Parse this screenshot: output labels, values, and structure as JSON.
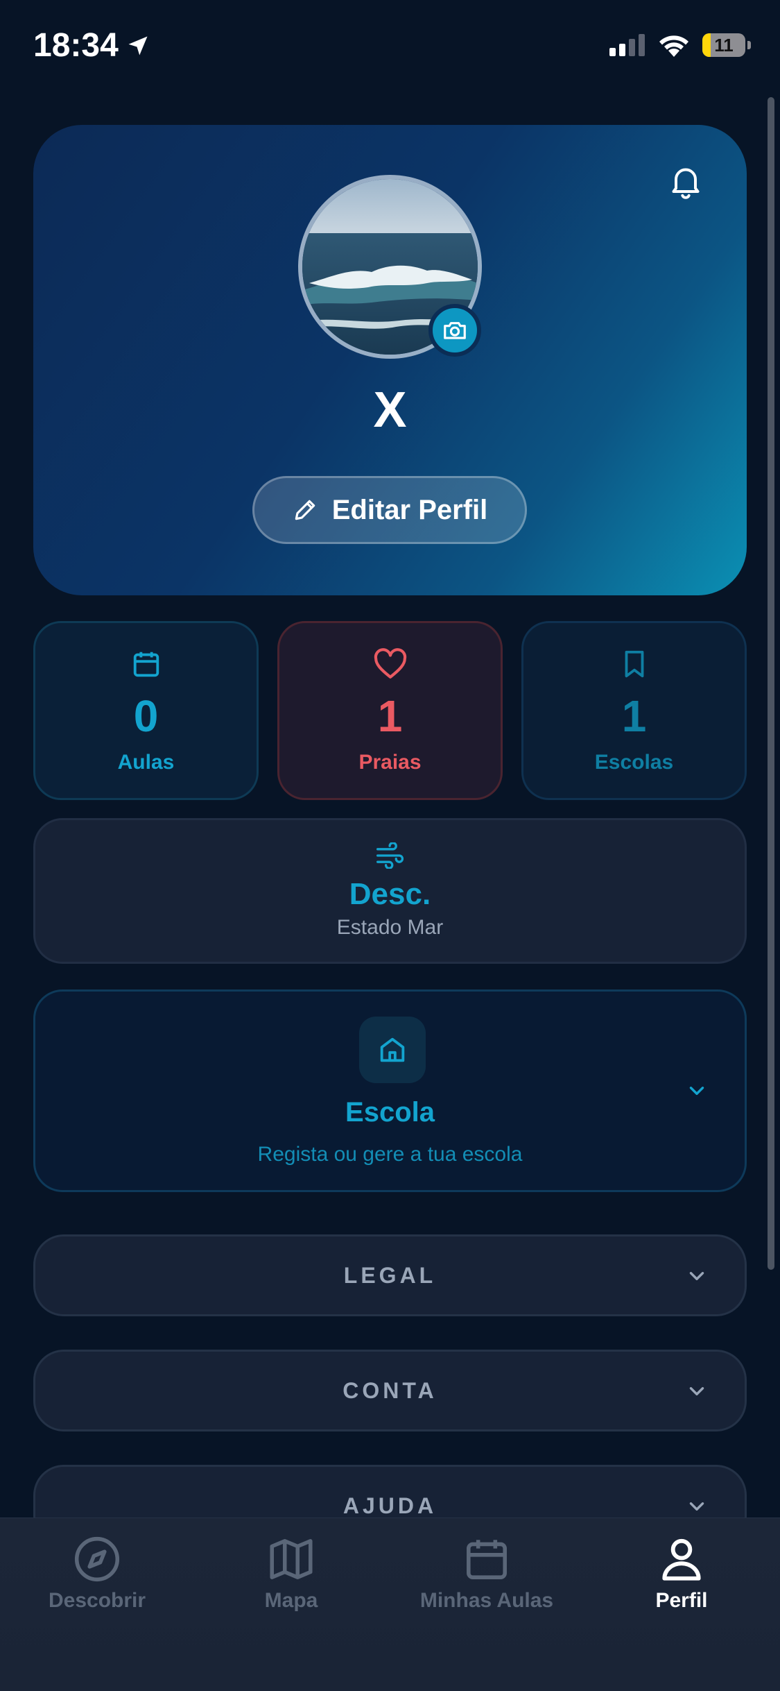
{
  "status_bar": {
    "time": "18:34",
    "battery": "11"
  },
  "header": {
    "username": "X",
    "edit_button": "Editar Perfil"
  },
  "stats": [
    {
      "value": "0",
      "label": "Aulas"
    },
    {
      "value": "1",
      "label": "Praias"
    },
    {
      "value": "1",
      "label": "Escolas"
    }
  ],
  "sea_state": {
    "value": "Desc.",
    "label": "Estado Mar"
  },
  "school": {
    "title": "Escola",
    "subtitle": "Regista ou gere a tua escola"
  },
  "sections": [
    {
      "title": "LEGAL"
    },
    {
      "title": "CONTA"
    },
    {
      "title": "AJUDA"
    }
  ],
  "tabbar": {
    "items": [
      {
        "label": "Descobrir",
        "icon": "compass-icon",
        "active": false
      },
      {
        "label": "Mapa",
        "icon": "map-icon",
        "active": false
      },
      {
        "label": "Minhas Aulas",
        "icon": "calendar-icon",
        "active": false
      },
      {
        "label": "Perfil",
        "icon": "user-icon",
        "active": true
      }
    ]
  },
  "colors": {
    "accent": "#13a4cf",
    "favorite": "#ea5a62",
    "background": "#071426"
  }
}
